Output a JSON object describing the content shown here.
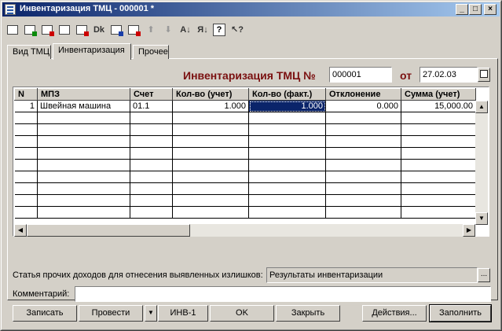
{
  "window": {
    "title": "Инвентаризация ТМЦ - 000001 *"
  },
  "titlebar_buttons": {
    "minimize": "_",
    "maximize": "□",
    "close": "×"
  },
  "toolbar": {
    "items": [
      {
        "name": "new-row-icon",
        "kind": "glyph"
      },
      {
        "name": "copy-row-icon",
        "kind": "glyph-grn"
      },
      {
        "name": "delete-row-icon",
        "kind": "glyph-red"
      },
      {
        "name": "edit-row-icon",
        "kind": "glyph"
      },
      {
        "name": "mark-deleted-icon",
        "kind": "glyph-red"
      },
      {
        "name": "dk-icon",
        "kind": "text",
        "text": "Dk"
      },
      {
        "name": "post-icon",
        "kind": "glyph-blu"
      },
      {
        "name": "structure-icon",
        "kind": "glyph-red"
      },
      {
        "name": "move-up-icon",
        "kind": "text-gray",
        "text": "⬆"
      },
      {
        "name": "move-down-icon",
        "kind": "text-gray",
        "text": "⬇"
      },
      {
        "name": "sort-asc-icon",
        "kind": "text",
        "text": "A↓"
      },
      {
        "name": "sort-desc-icon",
        "kind": "text",
        "text": "Я↓"
      },
      {
        "name": "help-icon",
        "kind": "help",
        "text": "?"
      },
      {
        "name": "help-pointer-icon",
        "kind": "text",
        "text": "↖?"
      }
    ]
  },
  "tabs": [
    {
      "label": "Вид ТМЦ",
      "active": false
    },
    {
      "label": "Инвентаризация",
      "active": true
    },
    {
      "label": "Прочее",
      "active": false
    }
  ],
  "header": {
    "title": "Инвентаризация ТМЦ №",
    "number": "000001",
    "from_label": "от",
    "date": "27.02.03"
  },
  "table": {
    "columns": [
      "N",
      "МПЗ",
      "Счет",
      "Кол-во (учет)",
      "Кол-во (факт.)",
      "Отклонение",
      "Сумма (учет)"
    ],
    "rows": [
      [
        "1",
        "Швейная машина",
        "01.1",
        "1.000",
        "1.000",
        "0.000",
        "15,000.00"
      ]
    ],
    "empty_rows": 9
  },
  "income_item": {
    "label": "Статья прочих доходов для отнесения выявленных излишков:",
    "value": "Результаты инвентаризации",
    "select_label": "..."
  },
  "comment": {
    "label": "Комментарий:",
    "value": ""
  },
  "buttons": {
    "save": "Записать",
    "post": "Провести",
    "dropdown": "▼",
    "inv1": "ИНВ-1",
    "ok": "OK",
    "close": "Закрыть",
    "actions": "Действия...",
    "fill": "Заполнить"
  }
}
